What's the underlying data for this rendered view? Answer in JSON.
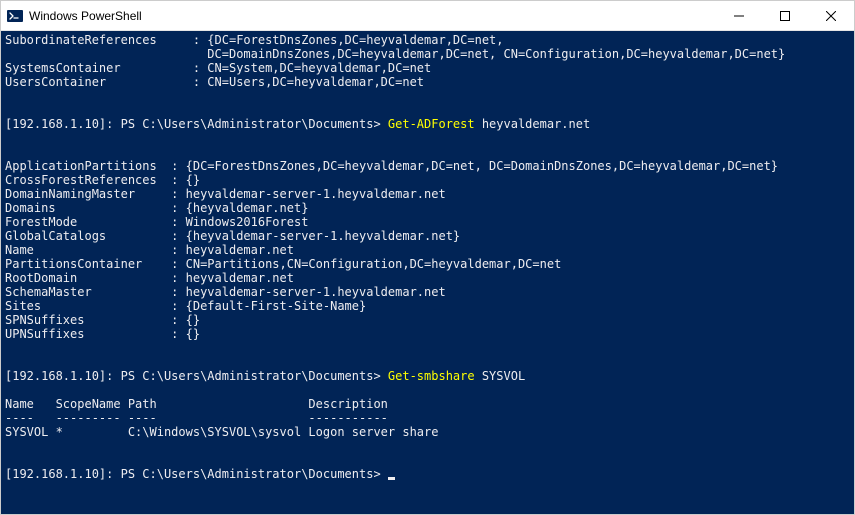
{
  "titlebar": {
    "title": "Windows PowerShell"
  },
  "terminal": {
    "top_block": {
      "keycol": 26,
      "rows": [
        {
          "key": "SubordinateReferences",
          "val": "{DC=ForestDnsZones,DC=heyvaldemar,DC=net,"
        },
        {
          "key": "",
          "val": "DC=DomainDnsZones,DC=heyvaldemar,DC=net, CN=Configuration,DC=heyvaldemar,DC=net}"
        },
        {
          "key": "SystemsContainer",
          "val": "CN=System,DC=heyvaldemar,DC=net"
        },
        {
          "key": "UsersContainer",
          "val": "CN=Users,DC=heyvaldemar,DC=net"
        }
      ]
    },
    "prompt1": {
      "prefix": "[192.168.1.10]: PS C:\\Users\\Administrator\\Documents> ",
      "cmd": "Get-ADForest",
      "arg": " heyvaldemar.net"
    },
    "forest_block": {
      "keycol": 23,
      "rows": [
        {
          "key": "ApplicationPartitions",
          "val": "{DC=ForestDnsZones,DC=heyvaldemar,DC=net, DC=DomainDnsZones,DC=heyvaldemar,DC=net}"
        },
        {
          "key": "CrossForestReferences",
          "val": "{}"
        },
        {
          "key": "DomainNamingMaster",
          "val": "heyvaldemar-server-1.heyvaldemar.net"
        },
        {
          "key": "Domains",
          "val": "{heyvaldemar.net}"
        },
        {
          "key": "ForestMode",
          "val": "Windows2016Forest"
        },
        {
          "key": "GlobalCatalogs",
          "val": "{heyvaldemar-server-1.heyvaldemar.net}"
        },
        {
          "key": "Name",
          "val": "heyvaldemar.net"
        },
        {
          "key": "PartitionsContainer",
          "val": "CN=Partitions,CN=Configuration,DC=heyvaldemar,DC=net"
        },
        {
          "key": "RootDomain",
          "val": "heyvaldemar.net"
        },
        {
          "key": "SchemaMaster",
          "val": "heyvaldemar-server-1.heyvaldemar.net"
        },
        {
          "key": "Sites",
          "val": "{Default-First-Site-Name}"
        },
        {
          "key": "SPNSuffixes",
          "val": "{}"
        },
        {
          "key": "UPNSuffixes",
          "val": "{}"
        }
      ]
    },
    "prompt2": {
      "prefix": "[192.168.1.10]: PS C:\\Users\\Administrator\\Documents> ",
      "cmd": "Get-smbshare",
      "arg": " SYSVOL"
    },
    "smb_table": {
      "header": "Name   ScopeName Path                     Description",
      "divider": "----   --------- ----                     -----------",
      "row": "SYSVOL *         C:\\Windows\\SYSVOL\\sysvol Logon server share"
    },
    "prompt3": {
      "prefix": "[192.168.1.10]: PS C:\\Users\\Administrator\\Documents> "
    }
  }
}
